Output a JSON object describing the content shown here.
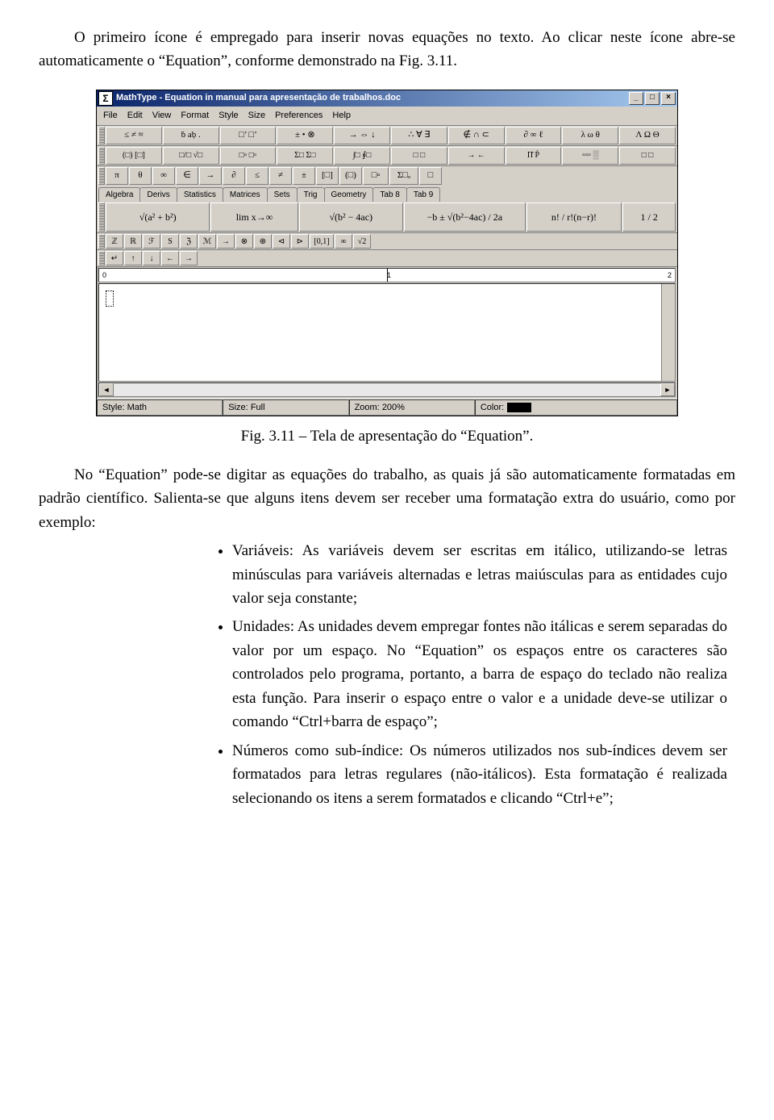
{
  "intro_para": "O primeiro ícone é empregado para inserir novas equações no texto. Ao clicar neste ícone abre-se automaticamente o “Equation”, conforme demonstrado na Fig. 3.11.",
  "figure_caption": "Fig. 3.11 – Tela de apresentação do “Equation”.",
  "after_para": "No “Equation” pode-se digitar as equações do trabalho, as quais já são automaticamente formatadas em padrão científico. Salienta-se que alguns itens devem ser receber uma formatação extra do usuário, como por exemplo:",
  "bullets": [
    "Variáveis: As variáveis devem ser escritas em itálico, utilizando-se letras minúsculas para variáveis alternadas e letras maiúsculas para as entidades cujo valor seja constante;",
    "Unidades: As unidades devem empregar fontes não itálicas e serem separadas do valor por um espaço. No “Equation” os espaços entre os caracteres são controlados pelo programa, portanto, a barra de espaço do teclado não realiza esta função. Para inserir o espaço entre o valor e a unidade deve-se utilizar o comando “Ctrl+barra de espaço”;",
    "Números como sub-índice: Os números utilizados nos sub-índices devem ser formatados para letras regulares (não-itálicos). Esta formatação é realizada selecionando os itens a serem formatados e clicando “Ctrl+e”;"
  ],
  "window": {
    "title": "MathType - Equation in manual para apresentação de trabalhos.doc",
    "menus": [
      "File",
      "Edit",
      "View",
      "Format",
      "Style",
      "Size",
      "Preferences",
      "Help"
    ],
    "palette_row1": [
      "≤ ≠ ≈",
      "ḃ aḅ .",
      "□’ □’",
      "± • ⊗",
      "→ ⇔ ↓",
      "∴ ∀ ∃",
      "∉ ∩ ⊂",
      "∂ ∞ ℓ",
      "λ ω θ",
      "Λ Ω Θ"
    ],
    "palette_row2": [
      "(□) [□]",
      "□/□ √□",
      "□▫ □▫",
      "Σ□ Σ□",
      "∫□ ∮□",
      "□ □",
      "→ ←",
      "Π̈ Ṕ",
      "▫▫▫ ░",
      "□ □"
    ],
    "tabs": [
      "Algebra",
      "Derivs",
      "Statistics",
      "Matrices",
      "Sets",
      "Trig",
      "Geometry",
      "Tab 8",
      "Tab 9"
    ],
    "tab_greek": [
      "π",
      "θ",
      "∞",
      "∈",
      "→",
      "∂",
      "≤",
      "≠",
      "±",
      "[□]",
      "(□)",
      "□▫",
      "Σ□ₒ",
      "□"
    ],
    "big_exprs": [
      "√(a² + b²)",
      "lim x→∞",
      "√(b² − 4ac)",
      "−b ± √(b²−4ac) / 2a",
      "n! / r!(n−r)!",
      "1 / 2"
    ],
    "mini_row": [
      "ℤ",
      "ℝ",
      "ℱ",
      "S",
      "ℨ",
      "ℳ",
      "→",
      "⊗",
      "⊕",
      "⊲",
      "⊳",
      "[0,1]",
      "∞",
      "√2"
    ],
    "arrow_row": [
      "↵",
      "↑",
      "↓",
      "←",
      "→"
    ],
    "ruler_labels": [
      "0",
      "1",
      "2"
    ],
    "status": {
      "style_label": "Style:",
      "style_value": "Math",
      "size_label": "Size:",
      "size_value": "Full",
      "zoom_label": "Zoom:",
      "zoom_value": "200%",
      "color_label": "Color:"
    }
  }
}
